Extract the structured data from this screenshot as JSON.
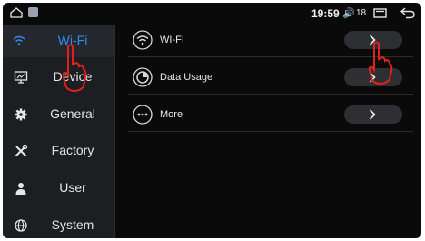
{
  "status_bar": {
    "time": "19:59",
    "volume_icon": "volume-icon",
    "volume_level": "18"
  },
  "sidebar": {
    "items": [
      {
        "label": "Wi-Fi",
        "icon": "wifi-icon",
        "active": true
      },
      {
        "label": "Device",
        "icon": "monitor-icon",
        "active": false
      },
      {
        "label": "General",
        "icon": "gear-icon",
        "active": false
      },
      {
        "label": "Factory",
        "icon": "tools-icon",
        "active": false
      },
      {
        "label": "User",
        "icon": "user-icon",
        "active": false
      },
      {
        "label": "System",
        "icon": "globe-icon",
        "active": false
      }
    ]
  },
  "main": {
    "rows": [
      {
        "label": "WI-FI",
        "icon": "wifi-icon"
      },
      {
        "label": "Data Usage",
        "icon": "data-usage-icon"
      },
      {
        "label": "More",
        "icon": "more-icon"
      }
    ]
  },
  "colors": {
    "accent": "#2f8cf0",
    "annotation": "#e0201a"
  }
}
